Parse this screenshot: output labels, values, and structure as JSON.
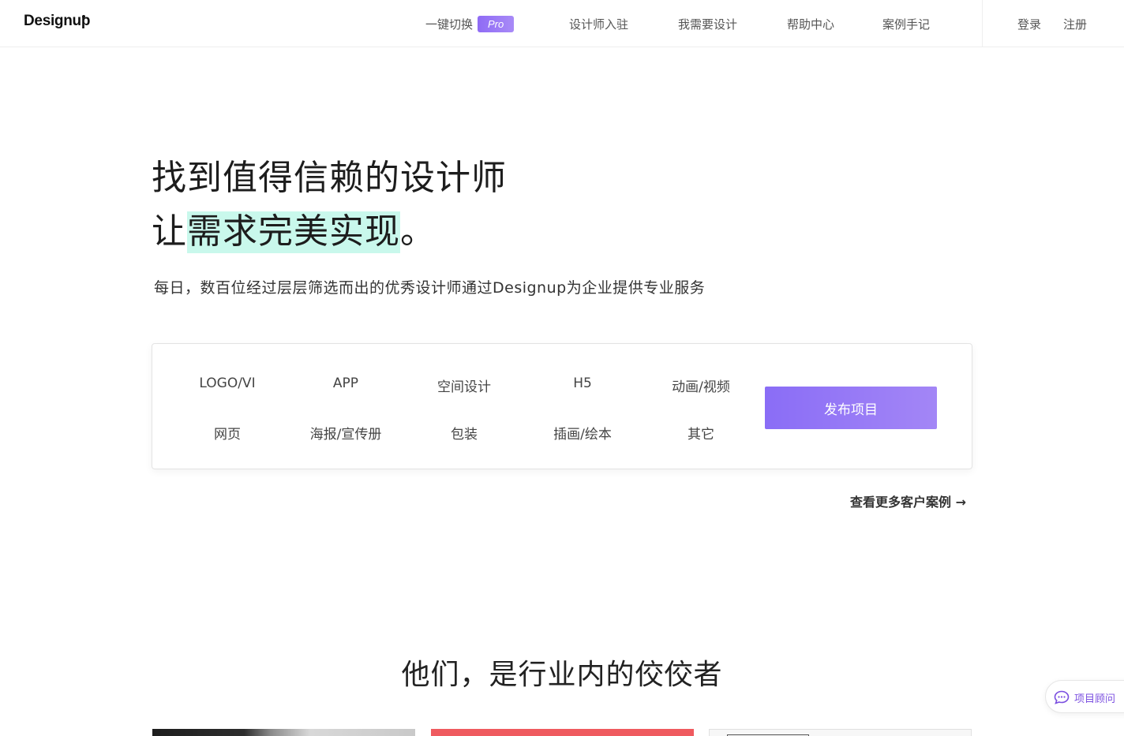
{
  "header": {
    "logo": "Designup",
    "nav": [
      {
        "label": "一键切换",
        "badge": "Pro"
      },
      {
        "label": "设计师入驻"
      },
      {
        "label": "我需要设计"
      },
      {
        "label": "帮助中心"
      },
      {
        "label": "案例手记"
      }
    ],
    "login": "登录",
    "register": "注册"
  },
  "hero": {
    "line1": "找到值得信赖的设计师",
    "line2_prefix": "让",
    "line2_highlight": "需求完美实现",
    "line2_suffix": "。",
    "subtitle": "每日，数百位经过层层筛选而出的优秀设计师通过Designup为企业提供专业服务",
    "highlight_color": "#c9f8ec"
  },
  "categories": {
    "row1": [
      "LOGO/VI",
      "APP",
      "空间设计",
      "H5",
      "动画/视频"
    ],
    "row2": [
      "网页",
      "海报/宣传册",
      "包装",
      "插画/绘本",
      "其它"
    ],
    "publish_button": "发布项目",
    "accent_color": "#8a6df6"
  },
  "more_cases": {
    "label": "查看更多客户案例",
    "arrow": "→"
  },
  "section": {
    "title": "他们，是行业内的佼佼者"
  },
  "advisor": {
    "label": "项目顾问",
    "icon": "chat-bubble-icon"
  }
}
